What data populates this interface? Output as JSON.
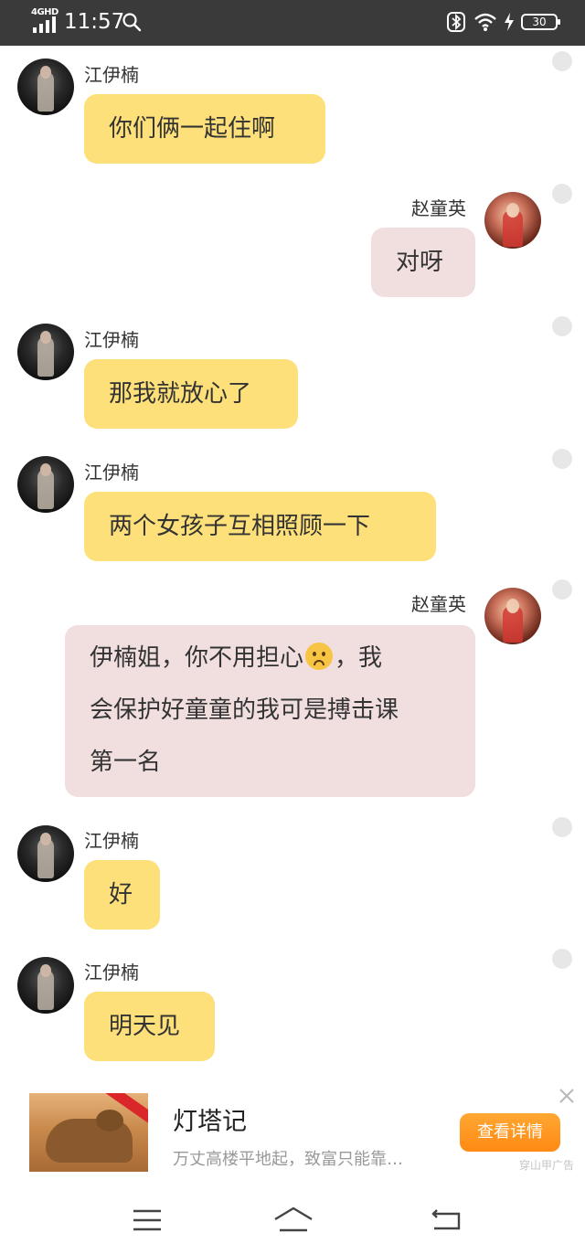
{
  "status_bar": {
    "network": "4GHD",
    "time": "11:57",
    "battery": "30"
  },
  "messages": [
    {
      "sender": "江伊楠",
      "text": "你们俩一起住啊",
      "side": "left"
    },
    {
      "sender": "赵童英",
      "text": "对呀",
      "side": "right"
    },
    {
      "sender": "江伊楠",
      "text": "那我就放心了",
      "side": "left"
    },
    {
      "sender": "江伊楠",
      "text": "两个女孩子互相照顾一下",
      "side": "left"
    },
    {
      "sender": "赵童英",
      "line1_before": "伊楠姐，你不用担心",
      "emoji": "worried-face-emoji",
      "line1_after": "，我",
      "line2": "会保护好童童的我可是搏击课",
      "line3": "第一名",
      "side": "right"
    },
    {
      "sender": "江伊楠",
      "text": "好",
      "side": "left"
    },
    {
      "sender": "江伊楠",
      "text": "明天见",
      "side": "left"
    }
  ],
  "ad": {
    "title": "灯塔记",
    "description": "万丈高楼平地起，致富只能靠…",
    "button": "查看详情",
    "source": "穿山甲广告"
  },
  "colors": {
    "status_bar": "#3a3a3a",
    "left_bubble": "#fde07a",
    "right_bubble": "#f1dfe0",
    "ad_button": "#ff9a22"
  }
}
